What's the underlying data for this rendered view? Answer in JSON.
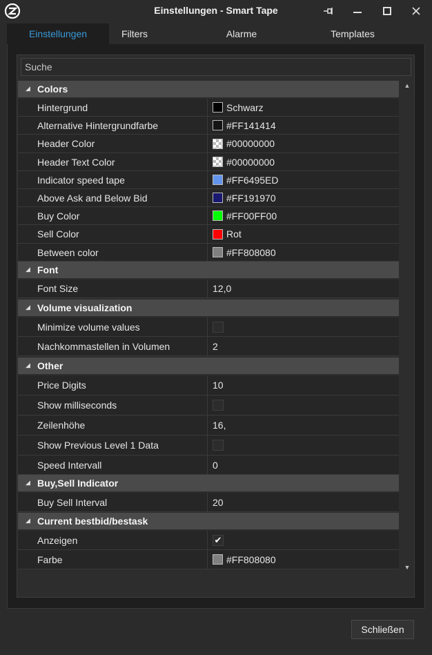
{
  "window": {
    "title": "Einstellungen - Smart Tape",
    "controls": [
      "pin-icon",
      "minimize-icon",
      "maximize-icon",
      "close-icon"
    ]
  },
  "tabs": [
    {
      "label": "Einstellungen",
      "active": true
    },
    {
      "label": "Filters",
      "active": false
    },
    {
      "label": "Alarme",
      "active": false
    },
    {
      "label": "Templates",
      "active": false
    }
  ],
  "search": {
    "placeholder": "Suche"
  },
  "accent_color": "#3A9AD9",
  "categories": {
    "colors": {
      "label": "Colors",
      "props": [
        {
          "name": "Hintergrund",
          "swatch": "#000000",
          "value": "Schwarz"
        },
        {
          "name": "Alternative Hintergrundfarbe",
          "swatch": "#141414",
          "value": "#FF141414"
        },
        {
          "name": "Header Color",
          "swatch": "transparent",
          "value": "#00000000"
        },
        {
          "name": "Header Text Color",
          "swatch": "transparent",
          "value": "#00000000"
        },
        {
          "name": "Indicator speed tape",
          "swatch": "#6495ED",
          "value": "#FF6495ED"
        },
        {
          "name": "Above Ask and Below Bid",
          "swatch": "#191970",
          "value": "#FF191970"
        },
        {
          "name": "Buy Color",
          "swatch": "#00FF00",
          "value": "#FF00FF00"
        },
        {
          "name": "Sell Color",
          "swatch": "#FF0000",
          "value": "Rot"
        },
        {
          "name": "Between color",
          "swatch": "#808080",
          "value": "#FF808080"
        }
      ]
    },
    "font": {
      "label": "Font",
      "props": [
        {
          "name": "Font Size",
          "value": "12,0"
        }
      ]
    },
    "volume": {
      "label": "Volume visualization",
      "props": [
        {
          "name": "Minimize volume values",
          "checked": false
        },
        {
          "name": "Nachkommastellen in Volumen",
          "value": "2"
        }
      ]
    },
    "other": {
      "label": "Other",
      "props": [
        {
          "name": "Price Digits",
          "value": "10"
        },
        {
          "name": "Show milliseconds",
          "checked": false
        },
        {
          "name": "Zeilenhöhe",
          "value": "16,"
        },
        {
          "name": "Show Previous Level 1 Data",
          "checked": false
        },
        {
          "name": "Speed Intervall",
          "value": "0"
        }
      ]
    },
    "buysell": {
      "label": "Buy,Sell Indicator",
      "props": [
        {
          "name": "Buy Sell Interval",
          "value": "20"
        }
      ]
    },
    "bestbid": {
      "label": "Current bestbid/bestask",
      "props": [
        {
          "name": "Anzeigen",
          "checked": true
        },
        {
          "name": "Farbe",
          "swatch": "#808080",
          "value": "#FF808080"
        }
      ]
    }
  },
  "footer": {
    "close_label": "Schließen"
  }
}
